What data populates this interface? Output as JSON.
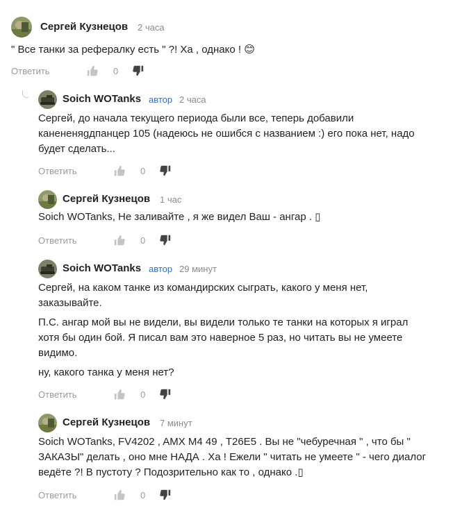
{
  "actions": {
    "reply_label": "Ответить",
    "like_count": "0"
  },
  "comments": [
    {
      "author": "Сергей Кузнецов",
      "badge": "",
      "time": "2 часа",
      "paragraphs": [
        "\" Все танки за рефералку есть \" ?! Ха , однако ! 😊"
      ]
    },
    {
      "author": "Soich WOTanks",
      "badge": "автор",
      "time": "2 часа",
      "paragraphs": [
        "Сергей, до начала текущего периода были все, теперь добавили канененяgдпанцер 105 (надеюсь не ошибся с названием :) его пока нет, надо будет сделать..."
      ]
    },
    {
      "author": "Сергей Кузнецов",
      "badge": "",
      "time": "1 час",
      "paragraphs": [
        "Soich WOTanks, Не заливайте , я же видел Ваш - ангар . ▯"
      ]
    },
    {
      "author": "Soich WOTanks",
      "badge": "автор",
      "time": "29 минут",
      "paragraphs": [
        "Сергей, на каком танке из командирских сыграть, какого у меня нет, заказывайте.",
        "П.С. ангар мой вы не видели, вы видели только те танки на которых я играл хотя бы один бой. Я писал вам это наверное 5 раз, но читать вы не умеете видимо.",
        "ну, какого танка у меня нет?"
      ]
    },
    {
      "author": "Сергей Кузнецов",
      "badge": "",
      "time": "7 минут",
      "paragraphs": [
        "Soich WOTanks, FV4202 , AMX M4 49 , T26E5 . Вы не \"чебуречная \" , что бы \" ЗАКАЗЫ\" делать , оно мне НАДА . Ха ! Ежели \" читать не умеете \" - чего диалог ведёте ?! В пустоту ? Подозрительно как то , однако .▯"
      ]
    }
  ]
}
